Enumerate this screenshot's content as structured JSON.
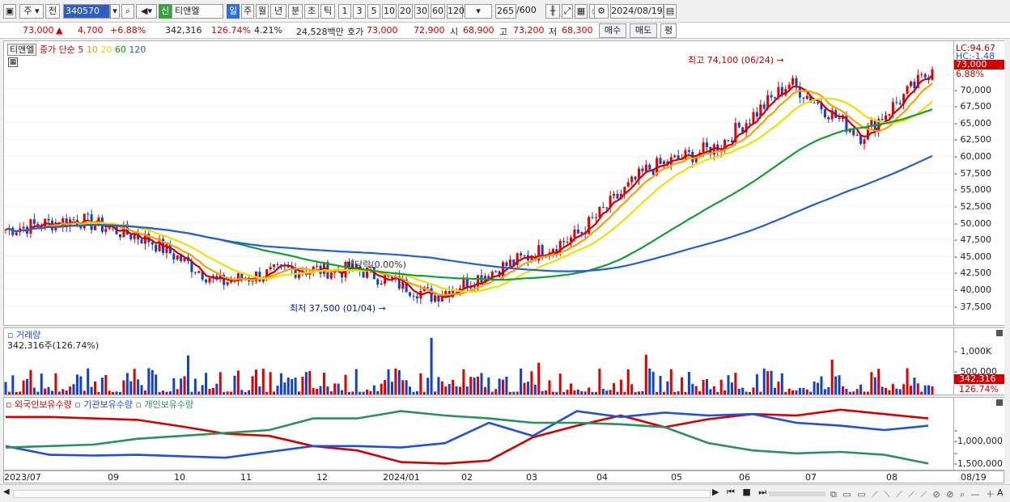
{
  "toolbar": {
    "market": "주",
    "prefix": "전",
    "code": "340570",
    "sentinel_badge": "신",
    "name": "티앤엘",
    "timeframes": [
      "일",
      "주",
      "월",
      "년",
      "분",
      "초",
      "틱"
    ],
    "selected_timeframe": "일",
    "periods": [
      "1",
      "3",
      "5",
      "10",
      "20",
      "30",
      "60",
      "120"
    ],
    "count": "265",
    "count_total": "/600",
    "date": "2024/08/19"
  },
  "quote": {
    "price": "73,000",
    "arrow": "▲",
    "change": "4,700",
    "change_pct": "+6.88%",
    "volume": "342,316",
    "vol_ratio": "126.74%",
    "turnover": "4.21%",
    "amount": "24,528백만",
    "hoga_label": "호가",
    "ask": "73,000",
    "bid": "72,900",
    "open_label": "시",
    "open": "68,900",
    "high_label": "고",
    "high": "73,200",
    "low_label": "저",
    "low": "68,300",
    "buy": "매수",
    "sell": "매도",
    "eval": "평"
  },
  "price_pane": {
    "stock": "티앤엘",
    "legend": [
      {
        "label": "종가 단순 5",
        "color": "#d40000"
      },
      {
        "label": "10",
        "color": "#ffa000"
      },
      {
        "label": "20",
        "color": "#e8d800"
      },
      {
        "label": "60",
        "color": "#00a000"
      },
      {
        "label": "120",
        "color": "#2060c0"
      }
    ],
    "lc_label": "LC:94.67",
    "hc_label": "HC:-1.48",
    "price_tag": "73,000",
    "pct_tag": "6.88%",
    "max_note": "최고 74,100 (06/24)",
    "min_note": "최저 37,500 (01/04)",
    "div_note": "배당락(0.00%)"
  },
  "volume_pane": {
    "title": "거래량",
    "sub": "342,316주(126.74%)",
    "tag": "342,316",
    "tag2": "126.74%",
    "ticks": [
      "1,000K",
      "500,000"
    ]
  },
  "holder_pane": {
    "legend": [
      {
        "label": "외국인보유수량",
        "color": "#d40000"
      },
      {
        "label": "기관보유수량",
        "color": "#2050d8"
      },
      {
        "label": "개인보유수량",
        "color": "#2a9060"
      }
    ],
    "ticks": [
      "-1,000,000",
      "-1,500,000"
    ]
  },
  "x_axis": {
    "labels": [
      "2023/07",
      "09",
      "10",
      "11",
      "12",
      "2024/01",
      "02",
      "03",
      "04",
      "05",
      "06",
      "07",
      "08"
    ],
    "end_label": "08/19"
  },
  "chart_data": [
    {
      "type": "candlestick",
      "title": "티앤엘",
      "price_scale": [
        37500,
        40000,
        42500,
        45000,
        47500,
        50000,
        52500,
        55000,
        57500,
        60000,
        62500,
        65000,
        67500,
        70000
      ],
      "close_path": [
        {
          "m": "2023/07",
          "v": 49000
        },
        {
          "m": "2023/08",
          "v": 50500
        },
        {
          "m": "2023/09",
          "v": 47500
        },
        {
          "m": "2023/10",
          "v": 41000
        },
        {
          "m": "2023/11",
          "v": 43000
        },
        {
          "m": "2023/12",
          "v": 42800
        },
        {
          "m": "2024/01",
          "v": 39000
        },
        {
          "m": "2024/02",
          "v": 43500
        },
        {
          "m": "2024/03",
          "v": 48000
        },
        {
          "m": "2024/04",
          "v": 58000
        },
        {
          "m": "2024/05",
          "v": 61500
        },
        {
          "m": "2024/06",
          "v": 71000
        },
        {
          "m": "2024/07",
          "v": 63000
        },
        {
          "m": "2024/08",
          "v": 73000
        }
      ],
      "max": 74100,
      "min": 37500
    },
    {
      "type": "bar",
      "title": "거래량",
      "last_value": 342316
    },
    {
      "type": "line",
      "title": "보유수량",
      "series": [
        {
          "name": "외국인보유수량"
        },
        {
          "name": "기관보유수량"
        },
        {
          "name": "개인보유수량"
        }
      ]
    }
  ],
  "bottom": {
    "icons": [
      "play-icon",
      "first-icon",
      "stop-icon",
      "last-icon",
      "zoom-out-icon",
      "zoom-in-icon"
    ],
    "end": "A"
  }
}
